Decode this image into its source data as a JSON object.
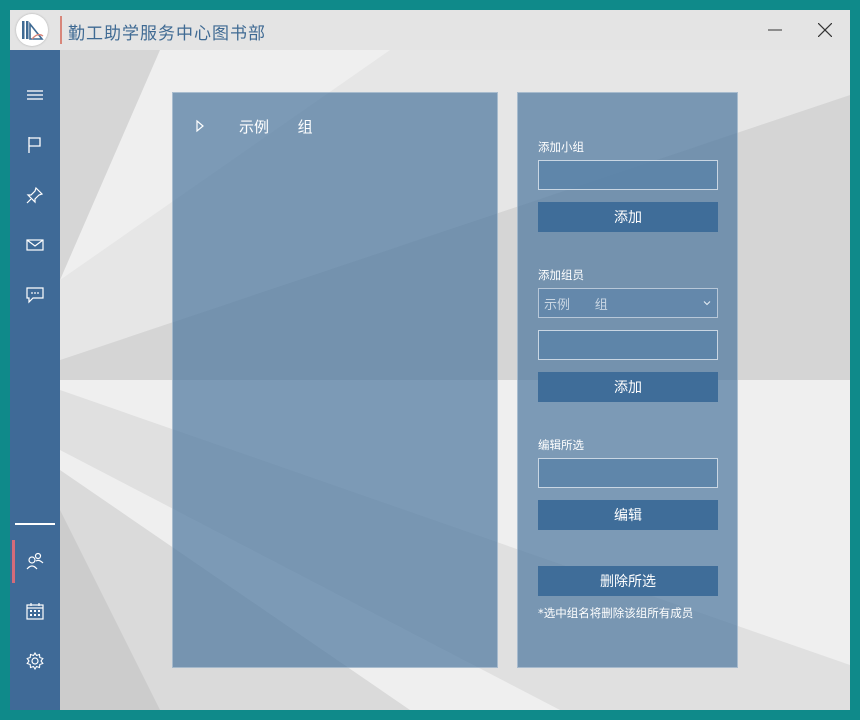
{
  "app": {
    "title": "勤工助学服务中心图书部"
  },
  "window_controls": {
    "minimize_icon": "minimize-icon",
    "close_icon": "close-icon"
  },
  "sidebar": {
    "top_items": [
      {
        "icon": "hamburger-menu-icon"
      },
      {
        "icon": "flag-icon"
      },
      {
        "icon": "pin-icon"
      },
      {
        "icon": "mail-icon"
      },
      {
        "icon": "chat-icon"
      }
    ],
    "bottom_items": [
      {
        "icon": "users-group-icon",
        "active": true
      },
      {
        "icon": "calendar-icon"
      },
      {
        "icon": "settings-gear-icon"
      }
    ],
    "active_color": "#d46b7a"
  },
  "tree": {
    "items": [
      {
        "label": "示例      组",
        "expanded": false
      }
    ]
  },
  "form": {
    "add_group": {
      "label": "添加小组",
      "value": "",
      "button": "添加"
    },
    "add_member": {
      "label": "添加组员",
      "selected_group": "示例      组",
      "value": "",
      "button": "添加"
    },
    "edit_selected": {
      "label": "编辑所选",
      "value": "",
      "button": "编辑"
    },
    "delete_selected": {
      "button": "删除所选",
      "hint": "*选中组名将删除该组所有成员"
    }
  },
  "colors": {
    "sidebar": "#3f6a97",
    "panel": "#4f78a0",
    "button": "#3f6d99",
    "outer_frame": "#0f8a8a",
    "title_accent": "#3f6a93"
  }
}
